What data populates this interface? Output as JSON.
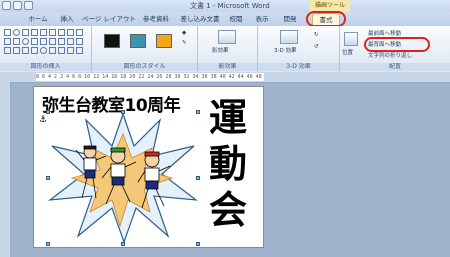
{
  "window": {
    "title": "文書 1 - Microsoft Word",
    "tool_context": "描画ツール"
  },
  "tabs": [
    {
      "label": "ホーム"
    },
    {
      "label": "挿入"
    },
    {
      "label": "ページ レイアウト"
    },
    {
      "label": "参考資料"
    },
    {
      "label": "差し込み文書"
    },
    {
      "label": "校閲"
    },
    {
      "label": "表示"
    },
    {
      "label": "開発"
    },
    {
      "label": "書式"
    }
  ],
  "ribbon": {
    "groups": {
      "insert_shapes": "図形の挿入",
      "shape_styles": "図形のスタイル",
      "shadow": "影効果",
      "three_d": "3-D 効果",
      "arrange": "配置"
    },
    "shadow_button": "影効果",
    "three_d_button": "3-D 効果",
    "position_button": "位置",
    "bring_front": "最前面へ移動",
    "send_back": "最背面へ移動",
    "text_wrap": "文字列の折り返し"
  },
  "style_colors": {
    "black": "#111111",
    "teal": "#3d95b0",
    "orange": "#f2a619"
  },
  "document": {
    "heading": "弥生台教室10周年",
    "vertical_title": "運動会",
    "anchor_symbol": "⚓",
    "ruler_text": "8 6 4 2 2 4 6 8 10 12 14 16 18 20 22 24 26 28 30 32 34 36 38 40 42 44 46 48"
  }
}
